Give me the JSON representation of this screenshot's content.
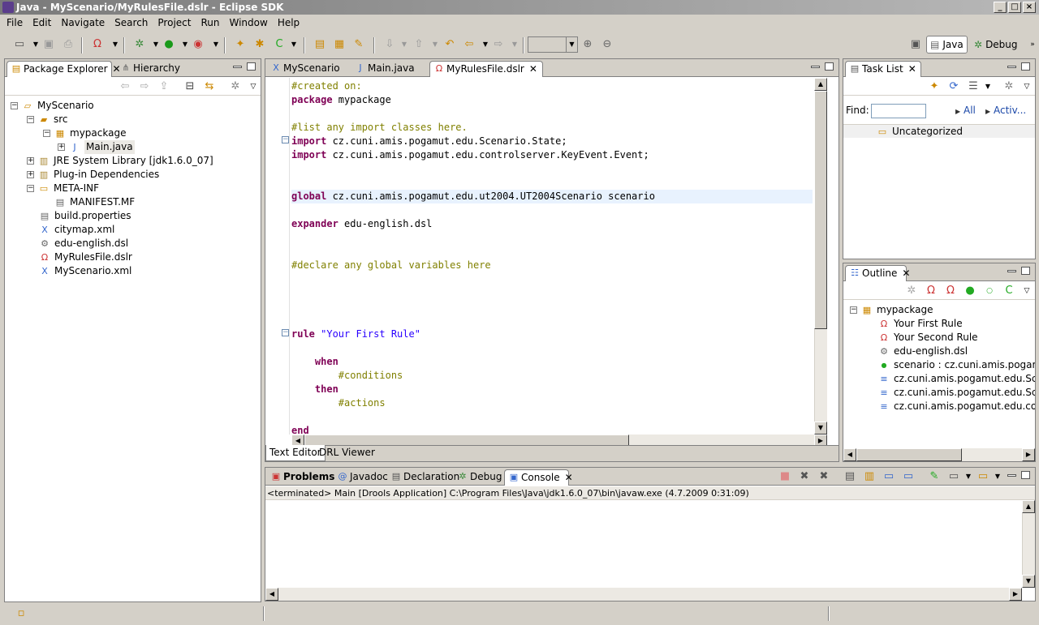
{
  "window": {
    "title": "Java - MyScenario/MyRulesFile.dslr - Eclipse SDK"
  },
  "menu": [
    "File",
    "Edit",
    "Navigate",
    "Search",
    "Project",
    "Run",
    "Window",
    "Help"
  ],
  "perspectives": {
    "java": "Java",
    "debug": "Debug"
  },
  "left_panel": {
    "tabs": [
      {
        "label": "Package Explorer"
      },
      {
        "label": "Hierarchy"
      }
    ],
    "tree": [
      {
        "label": "MyScenario"
      },
      {
        "label": "src"
      },
      {
        "label": "mypackage"
      },
      {
        "label": "Main.java"
      },
      {
        "label": "JRE System Library [jdk1.6.0_07]"
      },
      {
        "label": "Plug-in Dependencies"
      },
      {
        "label": "META-INF"
      },
      {
        "label": "MANIFEST.MF"
      },
      {
        "label": "build.properties"
      },
      {
        "label": "citymap.xml"
      },
      {
        "label": "edu-english.dsl"
      },
      {
        "label": "MyRulesFile.dslr"
      },
      {
        "label": "MyScenario.xml"
      }
    ]
  },
  "editor": {
    "tabs": [
      {
        "label": "MyScenario"
      },
      {
        "label": "Main.java"
      },
      {
        "label": "MyRulesFile.dslr"
      }
    ],
    "lines": [
      {
        "k": "",
        "r": "#created on:",
        "t": "cm"
      },
      {
        "k": "package",
        "r": " mypackage",
        "t": ""
      },
      {
        "k": "",
        "r": "",
        "t": ""
      },
      {
        "k": "",
        "r": "#list any import classes here.",
        "t": "cm"
      },
      {
        "k": "import",
        "r": " cz.cuni.amis.pogamut.edu.Scenario.State;",
        "t": ""
      },
      {
        "k": "import",
        "r": " cz.cuni.amis.pogamut.edu.controlserver.KeyEvent.Event;",
        "t": ""
      },
      {
        "k": "",
        "r": "",
        "t": ""
      },
      {
        "k": "",
        "r": "",
        "t": ""
      },
      {
        "k": "global",
        "r": " cz.cuni.amis.pogamut.edu.ut2004.UT2004Scenario scenario",
        "t": ""
      },
      {
        "k": "",
        "r": "",
        "t": ""
      },
      {
        "k": "expander",
        "r": " edu-english.dsl",
        "t": ""
      },
      {
        "k": "",
        "r": "",
        "t": ""
      },
      {
        "k": "",
        "r": "",
        "t": ""
      },
      {
        "k": "",
        "r": "#declare any global variables here",
        "t": "cm"
      },
      {
        "k": "",
        "r": "",
        "t": ""
      },
      {
        "k": "",
        "r": "",
        "t": ""
      },
      {
        "k": "",
        "r": "",
        "t": ""
      },
      {
        "k": "",
        "r": "",
        "t": ""
      },
      {
        "k": "rule",
        "r": " \"Your First Rule\"",
        "t": "st"
      },
      {
        "k": "",
        "r": "",
        "t": ""
      },
      {
        "k": "    when",
        "r": "",
        "t": ""
      },
      {
        "k": "",
        "r": "        #conditions",
        "t": "cm"
      },
      {
        "k": "    then",
        "r": "",
        "t": ""
      },
      {
        "k": "",
        "r": "        #actions",
        "t": "cm"
      },
      {
        "k": "",
        "r": "",
        "t": ""
      },
      {
        "k": "end",
        "r": "",
        "t": ""
      }
    ],
    "bottom_tabs": [
      "Text Editor",
      "DRL Viewer"
    ]
  },
  "tasklist": {
    "tab": "Task List",
    "find_label": "Find:",
    "find_value": "",
    "all": "All",
    "activ": "Activ...",
    "uncategorized": "Uncategorized"
  },
  "outline": {
    "tab": "Outline",
    "items": [
      {
        "label": "mypackage"
      },
      {
        "label": "Your First Rule"
      },
      {
        "label": "Your Second Rule"
      },
      {
        "label": "edu-english.dsl"
      },
      {
        "label": "scenario : cz.cuni.amis.pogamut.edu"
      },
      {
        "label": "cz.cuni.amis.pogamut.edu.Scenario"
      },
      {
        "label": "cz.cuni.amis.pogamut.edu.Scenario"
      },
      {
        "label": "cz.cuni.amis.pogamut.edu.controlse"
      }
    ]
  },
  "console": {
    "tabs": [
      {
        "label": "Problems"
      },
      {
        "label": "Javadoc"
      },
      {
        "label": "Declaration"
      },
      {
        "label": "Debug"
      },
      {
        "label": "Console"
      }
    ],
    "status": "<terminated> Main [Drools Application] C:\\Program Files\\Java\\jdk1.6.0_07\\bin\\javaw.exe (4.7.2009 0:31:09)"
  }
}
